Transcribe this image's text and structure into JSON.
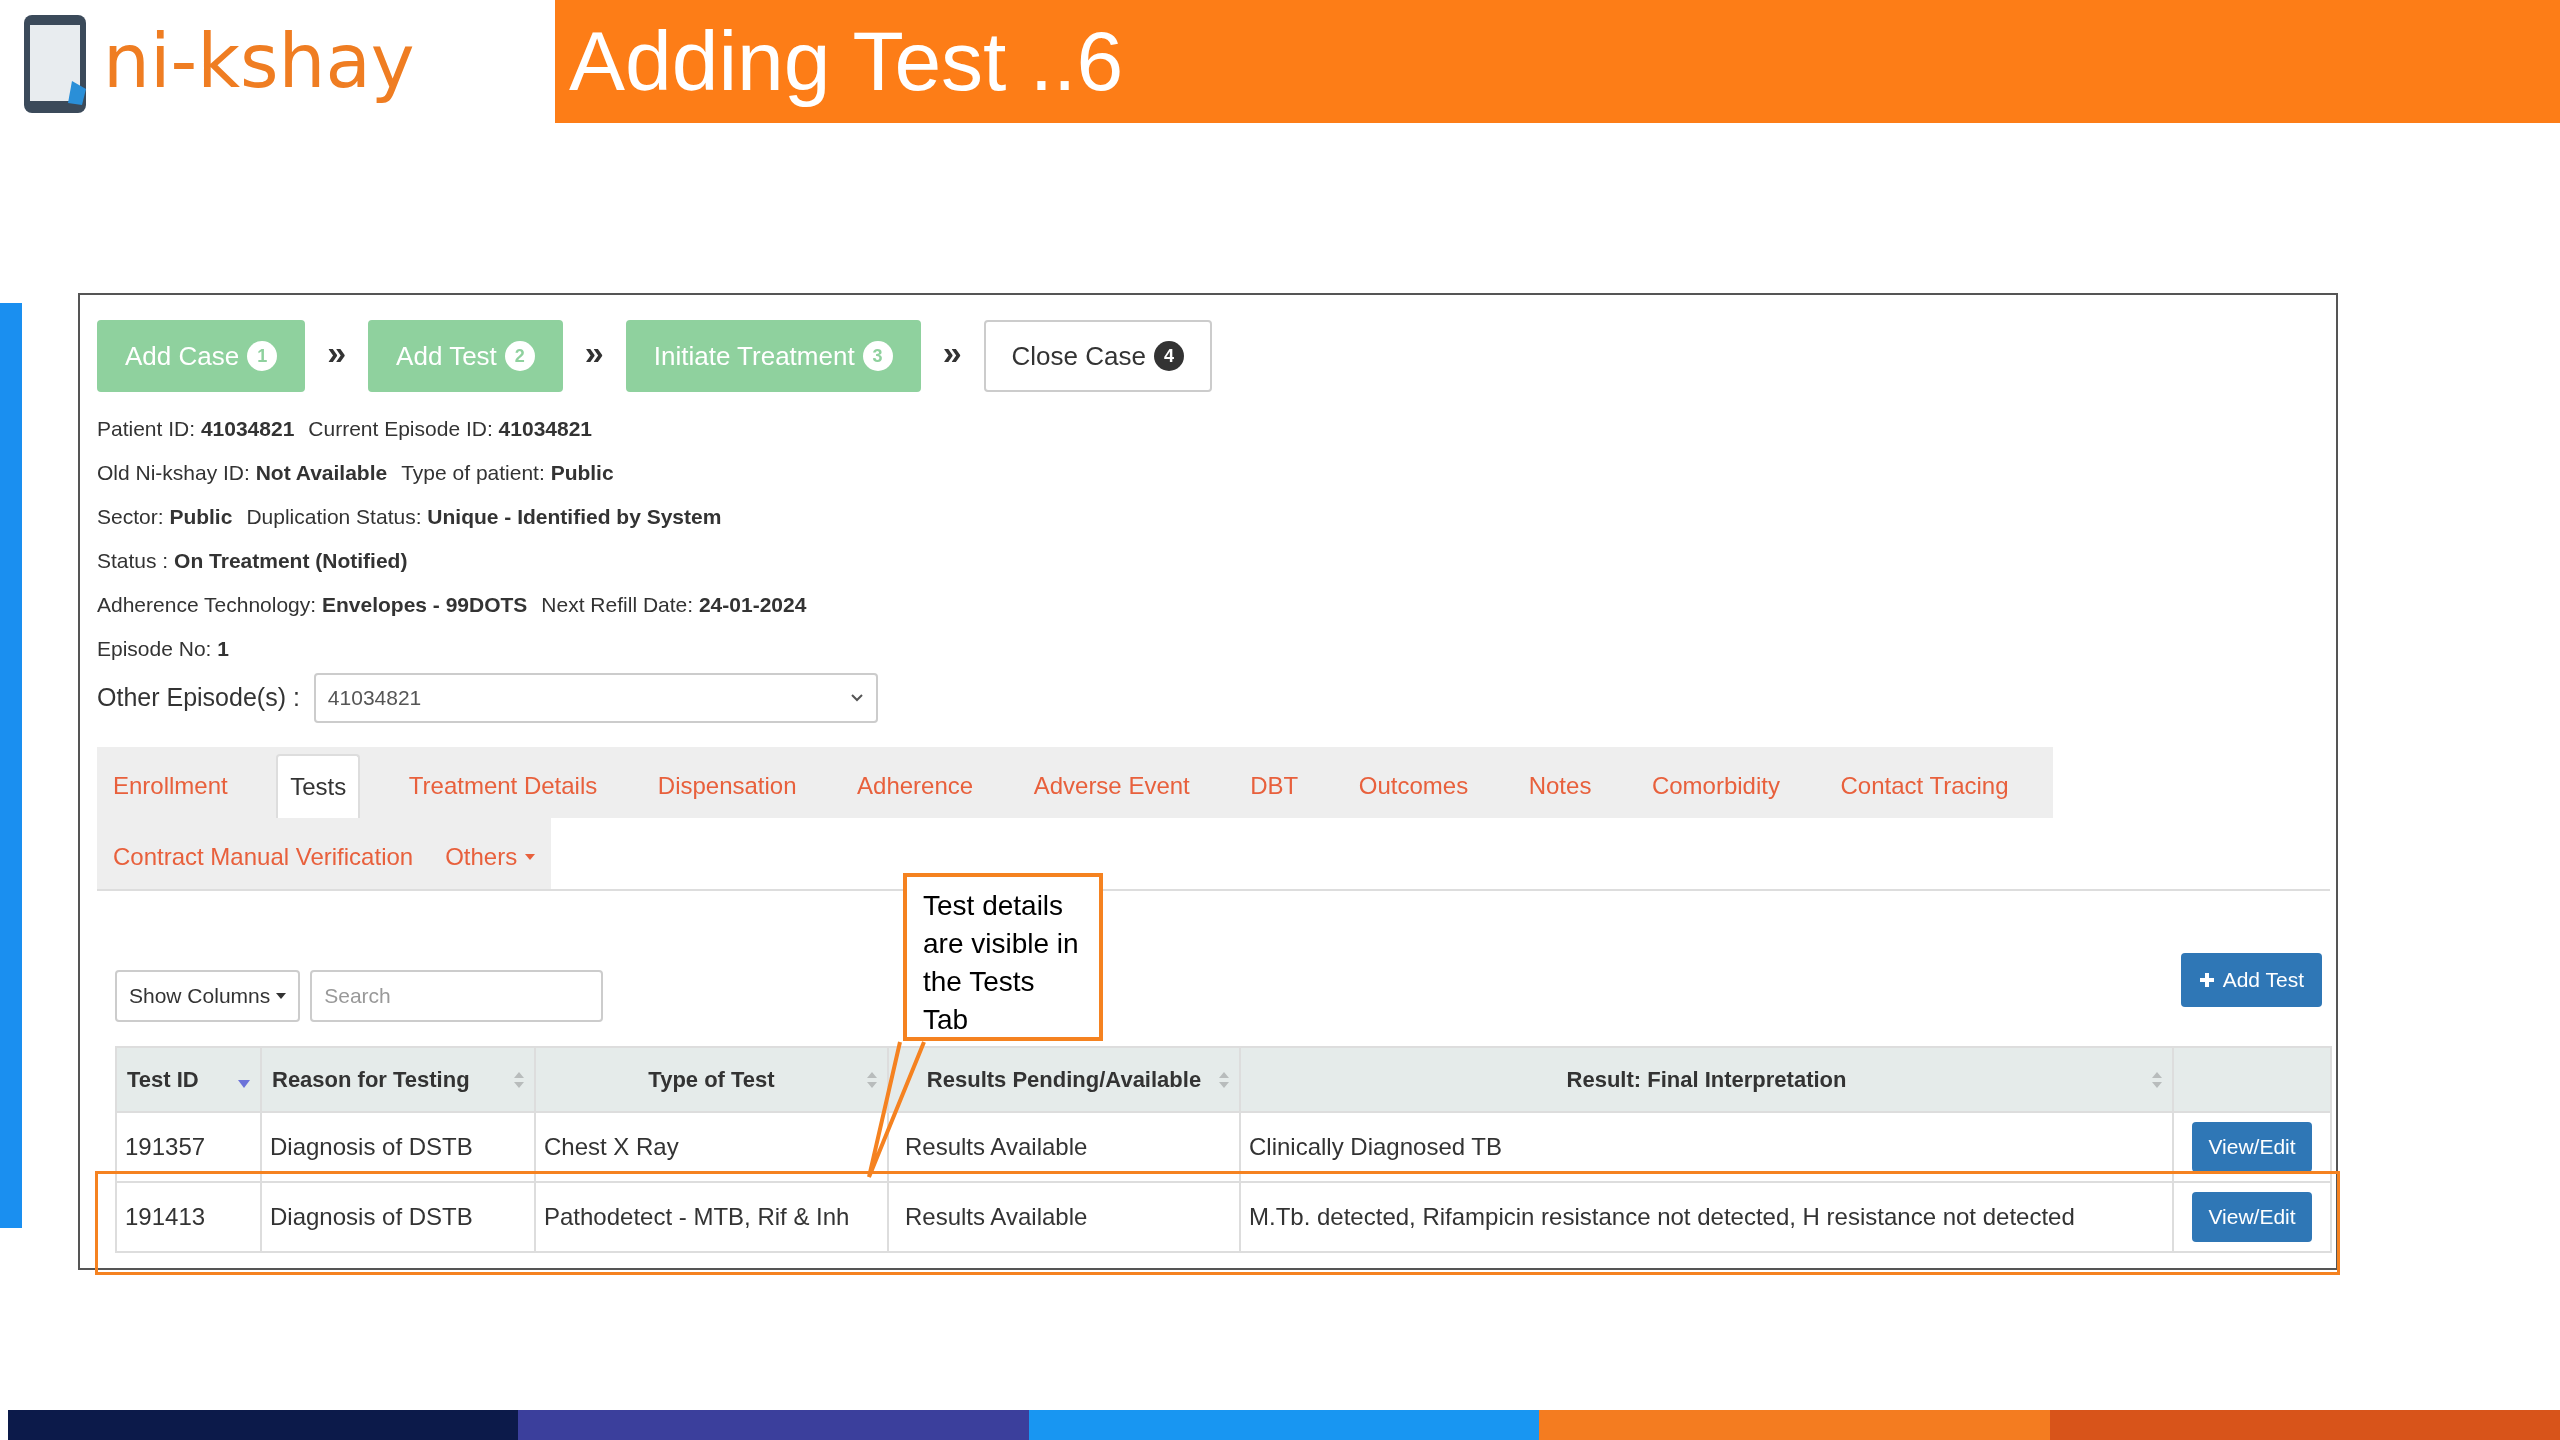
{
  "slide": {
    "logo_text": "ni-kshay",
    "title": "Adding Test ..6"
  },
  "steps": [
    {
      "label": "Add Case",
      "number": "1",
      "done": true
    },
    {
      "label": "Add Test",
      "number": "2",
      "done": true
    },
    {
      "label": "Initiate Treatment",
      "number": "3",
      "done": true
    },
    {
      "label": "Close Case",
      "number": "4",
      "done": false
    }
  ],
  "step_separator": "»",
  "info_lines": [
    [
      {
        "label": "Patient ID:",
        "value": "41034821"
      },
      {
        "label": "Current Episode ID:",
        "value": "41034821"
      }
    ],
    [
      {
        "label": "Old Ni-kshay ID:",
        "value": "Not Available"
      },
      {
        "label": "Type of patient:",
        "value": "Public"
      }
    ],
    [
      {
        "label": "Sector:",
        "value": "Public"
      },
      {
        "label": "Duplication Status:",
        "value": "Unique - Identified by System"
      }
    ],
    [
      {
        "label": "Status :",
        "value": "On Treatment (Notified)"
      }
    ],
    [
      {
        "label": "Adherence Technology:",
        "value": "Envelopes - 99DOTS"
      },
      {
        "label": "Next Refill Date:",
        "value": "24-01-2024"
      }
    ],
    [
      {
        "label": "Episode No:",
        "value": "1"
      }
    ]
  ],
  "other_episodes": {
    "label": "Other Episode(s) :",
    "value": "41034821"
  },
  "tabs": [
    {
      "label": "Enrollment",
      "selected": false,
      "kind": "tab"
    },
    {
      "label": "Tests",
      "selected": true,
      "kind": "tab"
    },
    {
      "label": "Treatment Details",
      "selected": false,
      "kind": "tab"
    },
    {
      "label": "Dispensation",
      "selected": false,
      "kind": "tab"
    },
    {
      "label": "Adherence",
      "selected": false,
      "kind": "tab"
    },
    {
      "label": "Adverse Event",
      "selected": false,
      "kind": "tab"
    },
    {
      "label": "DBT",
      "selected": false,
      "kind": "tab"
    },
    {
      "label": "Outcomes",
      "selected": false,
      "kind": "tab"
    },
    {
      "label": "Notes",
      "selected": false,
      "kind": "tab"
    },
    {
      "label": "Comorbidity",
      "selected": false,
      "kind": "tab"
    },
    {
      "label": "Contact Tracing",
      "selected": false,
      "kind": "tab"
    },
    {
      "label": "Contract Manual Verification",
      "selected": false,
      "kind": "tab"
    },
    {
      "label": "Others",
      "selected": false,
      "kind": "dropdown"
    }
  ],
  "toolbar": {
    "show_columns": "Show Columns",
    "search_placeholder": "Search",
    "add_button": "Add Test"
  },
  "table": {
    "columns": [
      {
        "label": "Test ID",
        "sorted": true
      },
      {
        "label": "Reason for Testing",
        "sorted": false
      },
      {
        "label": "Type of Test",
        "sorted": false
      },
      {
        "label": "Results Pending/Available",
        "sorted": false
      },
      {
        "label": "Result: Final Interpretation",
        "sorted": false
      }
    ],
    "rows": [
      {
        "cells": [
          "191357",
          "Diagnosis of DSTB",
          "Chest X Ray",
          "Results Available",
          "Clinically Diagnosed TB"
        ],
        "action": "View/Edit",
        "highlighted": false
      },
      {
        "cells": [
          "191413",
          "Diagnosis of DSTB",
          "Pathodetect - MTB, Rif & Inh",
          "Results Available",
          "M.Tb. detected, Rifampicin resistance not detected, H resistance not detected"
        ],
        "action": "View/Edit",
        "highlighted": true
      }
    ]
  },
  "callout": "Test details are visible in the Tests Tab"
}
